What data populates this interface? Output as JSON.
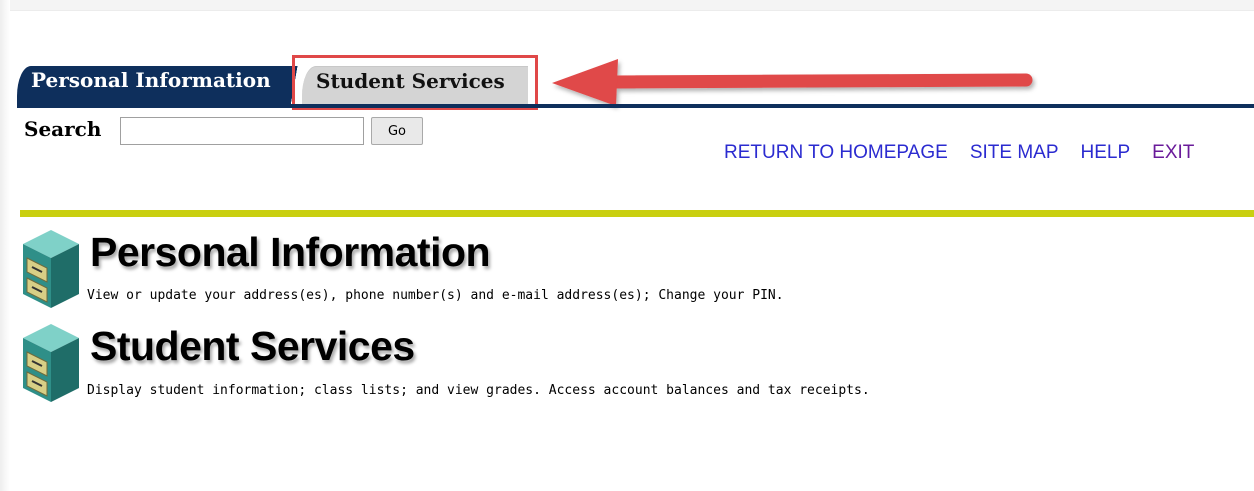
{
  "tabs": [
    {
      "label": "Personal Information",
      "active": true
    },
    {
      "label": "Student Services",
      "active": false
    }
  ],
  "search": {
    "label": "Search",
    "value": "",
    "button": "Go"
  },
  "links": [
    {
      "label": "RETURN TO HOMEPAGE"
    },
    {
      "label": "SITE MAP"
    },
    {
      "label": "HELP"
    },
    {
      "label": "EXIT"
    }
  ],
  "menu": [
    {
      "title": "Personal Information",
      "description": "View or update your address(es), phone number(s) and e-mail address(es); Change your PIN.",
      "icon": "file-cabinet-icon"
    },
    {
      "title": "Student Services",
      "description": "Display student information; class lists; and view grades. Access account balances and tax receipts.",
      "icon": "file-cabinet-icon"
    }
  ],
  "colors": {
    "nav_dark": "#0e2f5c",
    "tab_inactive": "#d4d4d4",
    "highlight": "#e04848",
    "link": "#2b2bd0",
    "link_visited": "#6a1b9a",
    "gold_divider": "#c9cf10",
    "cabinet": "#39a29a"
  }
}
